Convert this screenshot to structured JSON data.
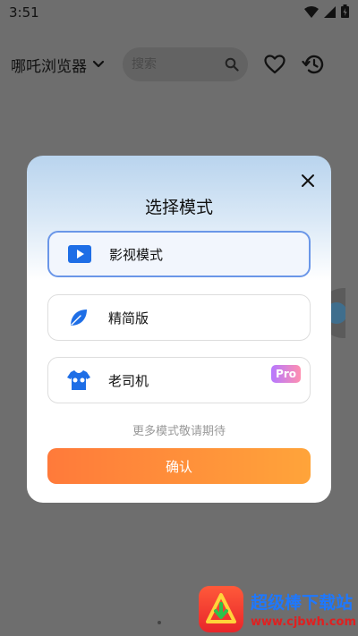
{
  "status_bar": {
    "time": "3:51"
  },
  "app_bar": {
    "title": "哪吒浏览器",
    "search_placeholder": "搜索"
  },
  "dialog": {
    "title": "选择模式",
    "options": [
      {
        "label": "影视模式",
        "icon": "play-icon",
        "selected": true
      },
      {
        "label": "精简版",
        "icon": "leaf-icon",
        "selected": false
      },
      {
        "label": "老司机",
        "icon": "tshirt-icon",
        "selected": false,
        "badge": "Pro"
      }
    ],
    "more_text": "更多模式敬请期待",
    "confirm_label": "确认"
  },
  "watermark": {
    "name": "超级棒下载站",
    "url": "www.cjbwh.com"
  },
  "colors": {
    "accent_blue": "#1e6ee6",
    "selected_border": "#6a96e8",
    "confirm_start": "#ff7a3a",
    "confirm_end": "#ffa43a"
  }
}
